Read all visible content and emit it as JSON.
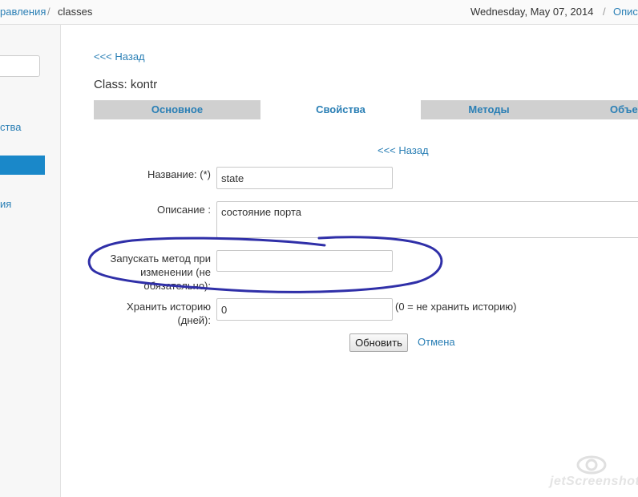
{
  "topbar": {
    "breadcrumb_link": "равления",
    "breadcrumb_sep": "/",
    "breadcrumb_current": "classes",
    "date": "Wednesday, May 07, 2014",
    "date_sep": "/",
    "right_link": "Опис"
  },
  "sidebar": {
    "item1": "ства",
    "item3": "ия"
  },
  "main": {
    "back_top": "<<< Назад",
    "class_title": "Class: kontr",
    "tabs": [
      {
        "label": "Основное",
        "active": false
      },
      {
        "label": "Свойства",
        "active": true
      },
      {
        "label": "Методы",
        "active": false
      },
      {
        "label": "Объе",
        "active": false
      }
    ],
    "back_mid": "<<< Назад"
  },
  "form": {
    "name_label": "Название: (*)",
    "name_value": "state",
    "description_label": "Описание :",
    "description_value": "состояние порта",
    "method_label": "Запускать метод при изменении (не обязательно):",
    "method_value": "",
    "history_label": "Хранить историю (дней):",
    "history_value": "0",
    "history_hint": "(0 = не хранить историю)",
    "update_button": "Обновить",
    "cancel_link": "Отмена"
  },
  "watermark": "jetScreenshot",
  "colors": {
    "link": "#2a7fb5",
    "tab_inactive": "#d0d0d0",
    "sidebar_active": "#1a88c9",
    "annotation": "#2f2fa8"
  }
}
